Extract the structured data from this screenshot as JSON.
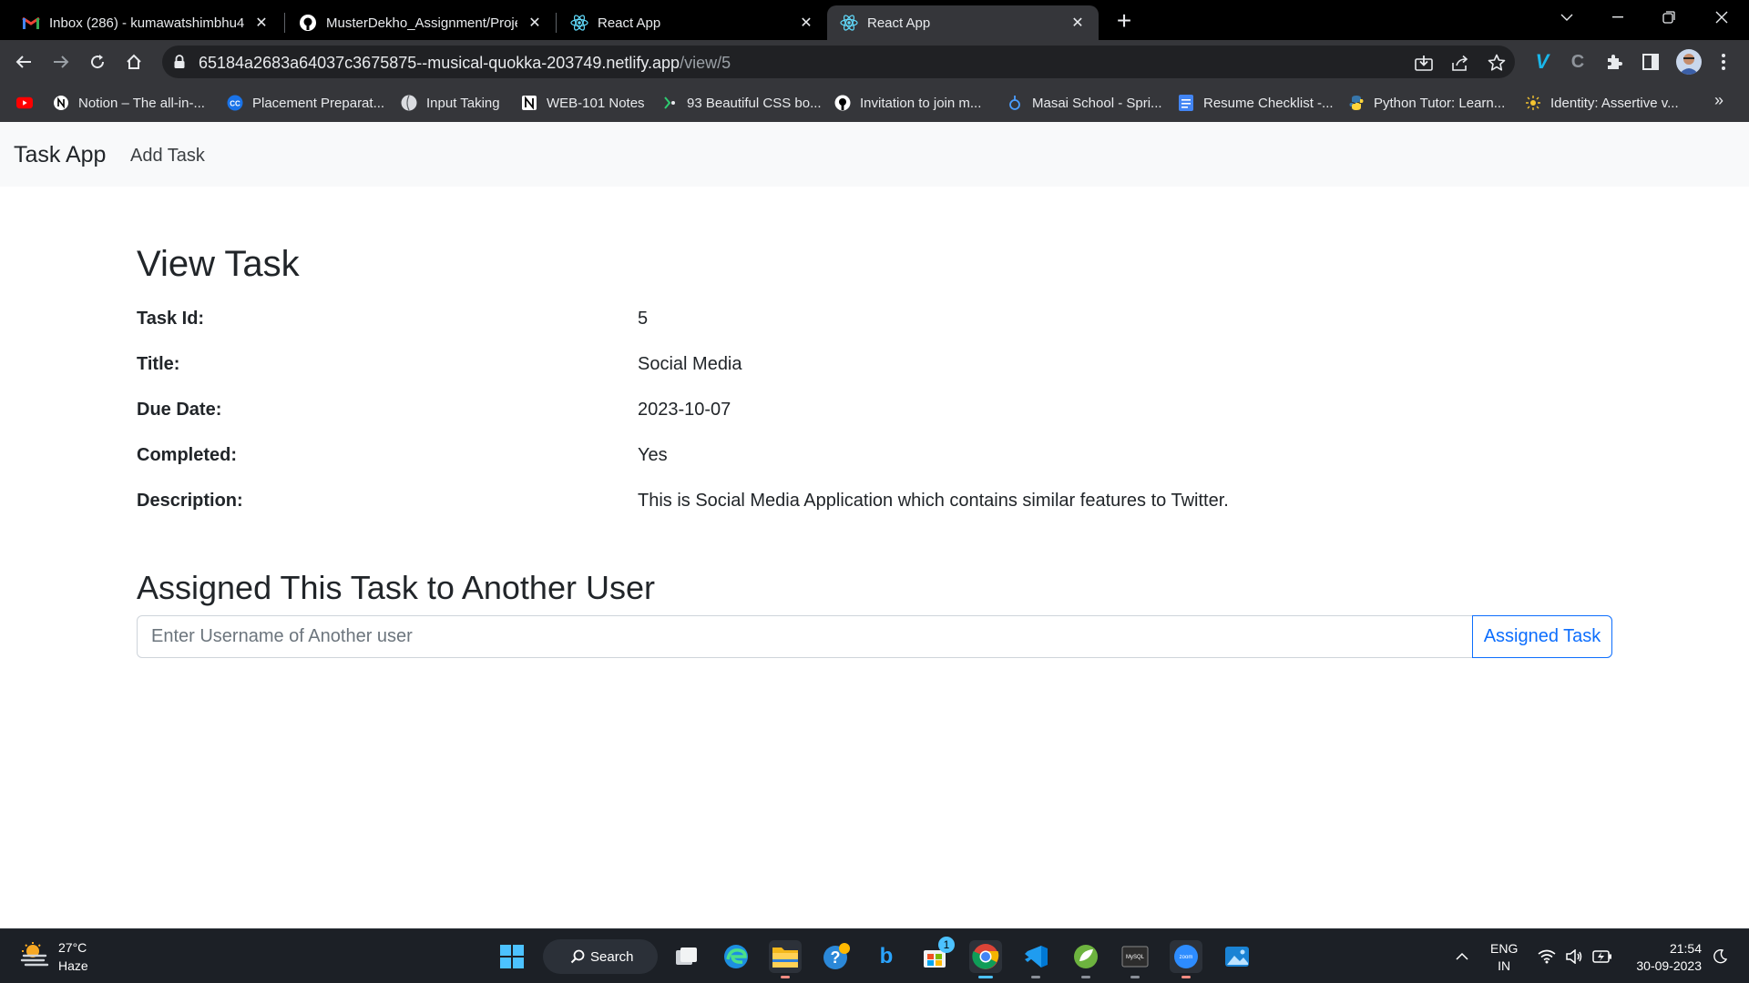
{
  "browser": {
    "tabs": [
      {
        "title": "Inbox (286) - kumawatshimbhu4",
        "icon": "gmail-icon"
      },
      {
        "title": "MusterDekho_Assignment/Proje",
        "icon": "github-icon"
      },
      {
        "title": "React App",
        "icon": "react-icon"
      },
      {
        "title": "React App",
        "icon": "react-icon",
        "active": true
      }
    ],
    "url_host": "65184a2683a64037c3675875--musical-quokka-203749.netlify.app",
    "url_path": "/view/5",
    "bookmarks": [
      {
        "label": "",
        "icon": "youtube-icon"
      },
      {
        "label": "Notion – The all-in-...",
        "icon": "notion-icon"
      },
      {
        "label": "Placement Preparat...",
        "icon": "cc-icon"
      },
      {
        "label": "Input Taking",
        "icon": "globe-icon"
      },
      {
        "label": "WEB-101 Notes",
        "icon": "notion-icon"
      },
      {
        "label": "93 Beautiful CSS bo...",
        "icon": "css-icon"
      },
      {
        "label": "Invitation to join m...",
        "icon": "github-icon"
      },
      {
        "label": "Masai School - Spri...",
        "icon": "masai-icon"
      },
      {
        "label": "Resume Checklist -...",
        "icon": "docs-icon"
      },
      {
        "label": "Python Tutor: Learn...",
        "icon": "python-icon"
      },
      {
        "label": "Identity: Assertive v...",
        "icon": "identity-icon"
      }
    ]
  },
  "app": {
    "brand": "Task App",
    "nav_add": "Add Task",
    "view_heading": "View Task",
    "fields": [
      {
        "label": "Task Id:",
        "value": "5"
      },
      {
        "label": "Title:",
        "value": "Social Media"
      },
      {
        "label": "Due Date:",
        "value": "2023-10-07"
      },
      {
        "label": "Completed:",
        "value": "Yes"
      },
      {
        "label": "Description:",
        "value": "This is Social Media Application which contains similar features to Twitter."
      }
    ],
    "assign_heading": "Assigned This Task to Another User",
    "assign_placeholder": "Enter Username of Another user",
    "assign_button": "Assigned Task"
  },
  "taskbar": {
    "weather_temp": "27°C",
    "weather_cond": "Haze",
    "search_label": "Search",
    "store_badge": "1",
    "lang_1": "ENG",
    "lang_2": "IN",
    "time": "21:54",
    "date": "30-09-2023"
  },
  "colors": {
    "accent": "#0d6efd",
    "chrome_dark": "#35363a",
    "page_nav_bg": "#f8f9fa"
  }
}
